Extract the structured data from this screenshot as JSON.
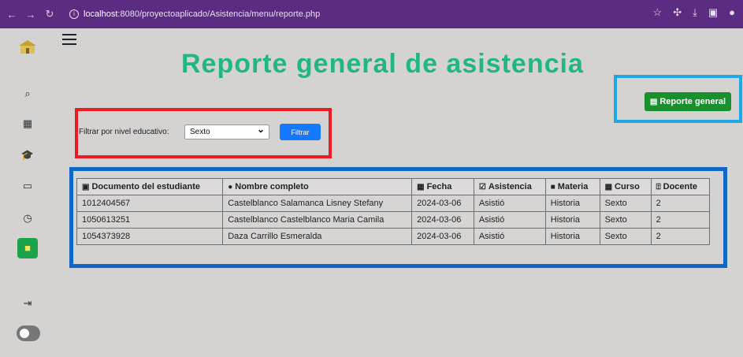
{
  "browser": {
    "url_host": "localhost",
    "url_rest": ":8080/proyectoaplicado/Asistencia/menu/reporte.php"
  },
  "page": {
    "title": "Reporte general de asistencia"
  },
  "report_button": {
    "label": "Reporte general"
  },
  "filter": {
    "label": "Filtrar por nivel educativo:",
    "selected": "Sexto",
    "button_label": "Filtrar"
  },
  "table": {
    "headers": [
      "Documento del estudiante",
      "Nombre completo",
      "Fecha",
      "Asistencia",
      "Materia",
      "Curso",
      "Docente"
    ],
    "rows": [
      [
        "1012404567",
        "Castelblanco Salamanca Lisney Stefany",
        "2024-03-06",
        "Asistió",
        "Historia",
        "Sexto",
        "2"
      ],
      [
        "1050613251",
        "Castelblanco Castelblanco Maria Camila",
        "2024-03-06",
        "Asistió",
        "Historia",
        "Sexto",
        "2"
      ],
      [
        "1054373928",
        "Daza Carrillo Esmeralda",
        "2024-03-06",
        "Asistió",
        "Historia",
        "Sexto",
        "2"
      ]
    ]
  },
  "colors": {
    "title": "#21b880",
    "report_button": "#1a8f2e",
    "filter_button": "#1677ff"
  }
}
